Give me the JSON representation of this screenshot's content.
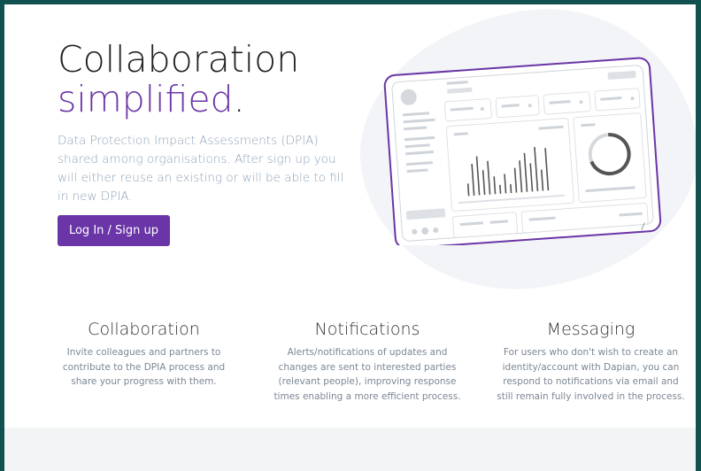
{
  "hero": {
    "title_line1": "Collaboration",
    "title_line2_accent": "simplified",
    "title_line2_dot": ".",
    "description": "Data Protection Impact Assessments (DPIA) shared among organisations. After sign up you will either reuse an existing or will be able to fill in new DPIA.",
    "cta_label": "Log In / Sign up"
  },
  "features": [
    {
      "title": "Collaboration",
      "text": "Invite colleagues and partners to contribute to the DPIA process and share your progress with them."
    },
    {
      "title": "Notifications",
      "text": "Alerts/notifications of updates and changes are sent to interested parties (relevant people), improving response times enabling a more efficient process."
    },
    {
      "title": "Messaging",
      "text": "For users who don't wish to create an identity/account with Dapian, you can respond to notifications via email and still remain fully involved in the process."
    }
  ],
  "colors": {
    "accent": "#6a35a6",
    "frame": "#11514f",
    "muted_text": "#8ea4b8"
  },
  "illustration": {
    "icon": "dashboard-illustration"
  }
}
